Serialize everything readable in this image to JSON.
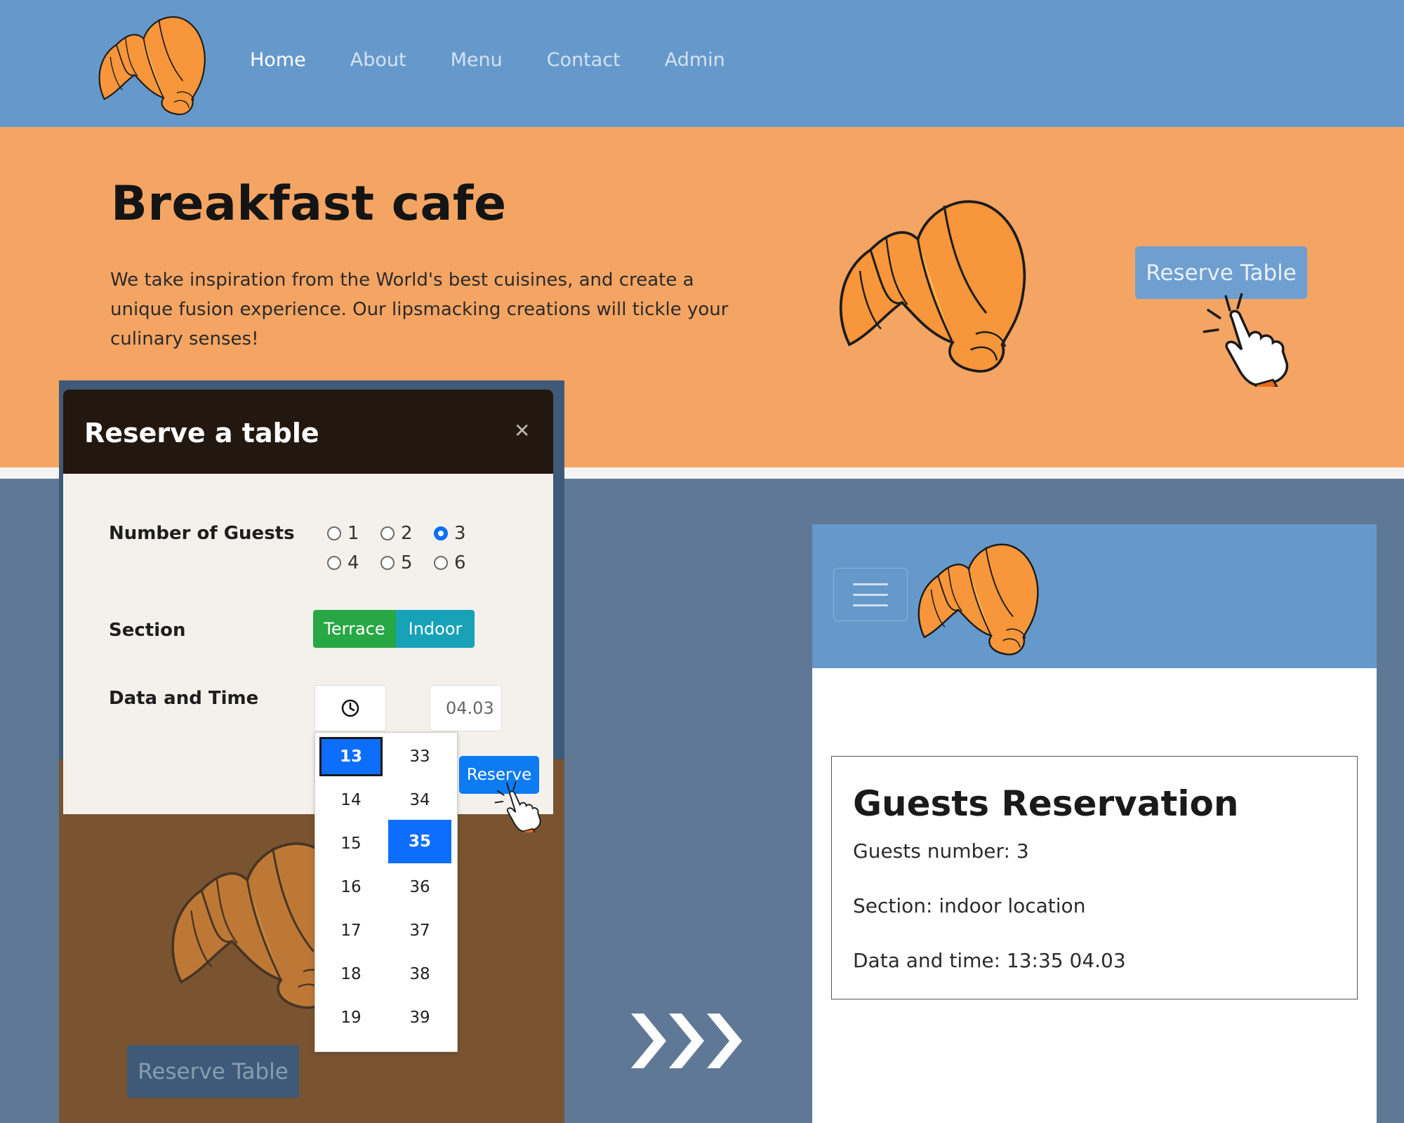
{
  "nav": {
    "items": [
      "Home",
      "About",
      "Menu",
      "Contact",
      "Admin"
    ],
    "logo_icon": "croissant-logo"
  },
  "hero": {
    "title": "Breakfast cafe",
    "text": "We take inspiration from the World's best cuisines, and create a unique fusion experience. Our lipsmacking creations will tickle your culinary senses!",
    "reserve_label": "Reserve Table"
  },
  "modal": {
    "title": "Reserve a table",
    "close_icon": "close-icon",
    "guests_label": "Number of Guests",
    "guest_options": [
      "1",
      "2",
      "3",
      "4",
      "5",
      "6"
    ],
    "guests_selected": "3",
    "section_label": "Section",
    "section_options": [
      "Terrace",
      "Indoor"
    ],
    "datetime_label": "Data and Time",
    "date_value": "04.03",
    "reserve_label": "Reserve"
  },
  "picker": {
    "hours": [
      "13",
      "14",
      "15",
      "16",
      "17",
      "18",
      "19"
    ],
    "minutes": [
      "33",
      "34",
      "35",
      "36",
      "37",
      "38",
      "39"
    ],
    "selected_hour": "13",
    "selected_minute": "35"
  },
  "background_page": {
    "reserve_label": "Reserve Table"
  },
  "result": {
    "title": "Guests Reservation",
    "guests": "Guests number: 3",
    "section": "Section: indoor location",
    "datetime": "Data and time: 13:35 04.03"
  },
  "colors": {
    "nav_blue": "#6699cb",
    "hero_orange": "#f5a563",
    "modal_header": "#23180f",
    "primary": "#0d6efd",
    "terrace_green": "#28a745",
    "indoor_teal": "#17a2b8"
  }
}
